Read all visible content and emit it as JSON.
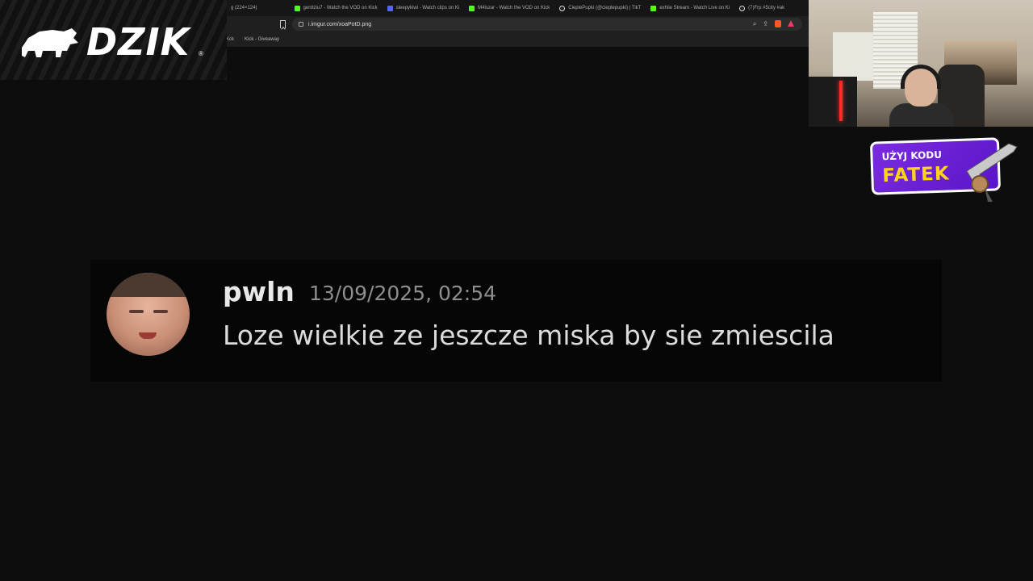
{
  "browser": {
    "tabs": [
      {
        "label": "g (224×124)",
        "favicon": "image-icon"
      },
      {
        "label": "gentlziu7 - Watch the VOD on Kick",
        "favicon": "kick-icon"
      },
      {
        "label": "sleepykiwi - Watch clips on Ki",
        "favicon": "discord-icon"
      },
      {
        "label": "M4lszar - Watch the VOD on Kick",
        "favicon": "kick-icon"
      },
      {
        "label": "CieplePupki (@cieplepupki) | TikT",
        "favicon": "tiktok-icon"
      },
      {
        "label": "exhiie Stream - Watch Live on Ki",
        "favicon": "kick-icon"
      },
      {
        "label": "(7)Frp #5city #ak",
        "favicon": "tiktok-icon"
      }
    ],
    "url": "i.imgur.com/xoaPotD.png",
    "bookmarks": [
      {
        "label": "Kck"
      },
      {
        "label": "Kick - Giveaway"
      }
    ],
    "zoom_icon": "zoom-icon",
    "share_icon": "share-icon"
  },
  "overlay": {
    "logo_text": "DZIK",
    "logo_reg": "®",
    "promo_line1": "UŻYJ KODU",
    "promo_code": "FATEK"
  },
  "message": {
    "author": "pwln",
    "timestamp": "13/09/2025, 02:54",
    "content": "Loze wielkie ze jeszcze miska by sie zmiescila"
  },
  "colors": {
    "background": "#0d0d0d",
    "message_bg": "#060606",
    "promo_purple": "#6a1fd6",
    "promo_yellow": "#ffd21a",
    "kick_green": "#53fc18"
  }
}
